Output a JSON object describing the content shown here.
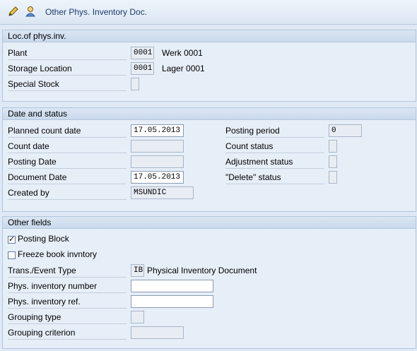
{
  "toolbar": {
    "title": "Other Phys. Inventory Doc.",
    "icons": [
      "pencil-icon",
      "user-icon"
    ]
  },
  "loc_group": {
    "title": "Loc.of phys.inv.",
    "plant_label": "Plant",
    "plant_value": "0001",
    "plant_desc": "Werk 0001",
    "sloc_label": "Storage Location",
    "sloc_value": "0001",
    "sloc_desc": "Lager 0001",
    "special_stock_label": "Special Stock",
    "special_stock_value": ""
  },
  "date_group": {
    "title": "Date and status",
    "planned_count_date_label": "Planned count date",
    "planned_count_date_value": "17.05.2013",
    "count_date_label": "Count date",
    "count_date_value": "",
    "posting_date_label": "Posting Date",
    "posting_date_value": "",
    "document_date_label": "Document Date",
    "document_date_value": "17.05.2013",
    "created_by_label": "Created by",
    "created_by_value": "MSUNDIC",
    "posting_period_label": "Posting period",
    "posting_period_value": "0",
    "count_status_label": "Count status",
    "count_status_value": "",
    "adjustment_status_label": "Adjustment status",
    "adjustment_status_value": "",
    "delete_status_label": "\"Delete\" status",
    "delete_status_value": ""
  },
  "other_group": {
    "title": "Other fields",
    "posting_block_label": "Posting Block",
    "posting_block_checked": true,
    "posting_block_mark": "✓",
    "freeze_label": "Freeze book invntory",
    "freeze_checked": false,
    "trans_label": "Trans./Event Type",
    "trans_value": "IB",
    "trans_desc": "Physical Inventory Document",
    "phys_inv_number_label": "Phys. inventory number",
    "phys_inv_number_value": "",
    "phys_inv_ref_label": "Phys. inventory ref.",
    "phys_inv_ref_value": "",
    "grouping_type_label": "Grouping type",
    "grouping_type_value": "",
    "grouping_criterion_label": "Grouping criterion",
    "grouping_criterion_value": ""
  }
}
